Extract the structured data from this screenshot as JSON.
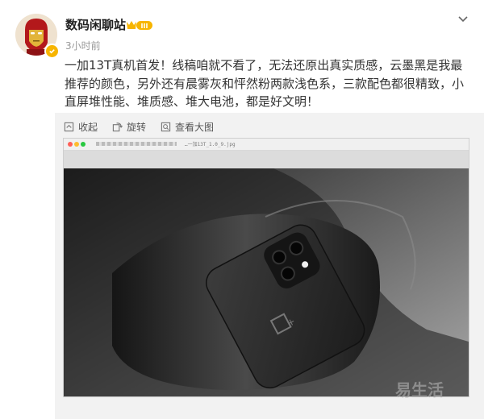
{
  "header": {
    "username": "数码闲聊站",
    "badge_text": "III",
    "time": "3小时前"
  },
  "post": {
    "text": "一加13T真机首发！线稿咱就不看了，无法还原出真实质感，云墨黑是我最推荐的颜色，另外还有晨雾灰和怦然粉两款浅色系，三款配色都很精致，小直屏堆性能、堆质感、堆大电池，都是好文明！"
  },
  "toolbar": {
    "collect": "收起",
    "rotate": "旋转",
    "view_large": "查看大图"
  },
  "viewer": {
    "filename": "…一加13T_1.0_9.jpg"
  },
  "watermark": "易生活",
  "colors": {
    "badge": "#f7b500",
    "verify": "#f7b500",
    "time": "#999999"
  },
  "icons": {
    "more": "chevron-down-icon",
    "collect": "collapse-icon",
    "rotate": "rotate-icon",
    "view_large": "zoom-in-icon"
  }
}
